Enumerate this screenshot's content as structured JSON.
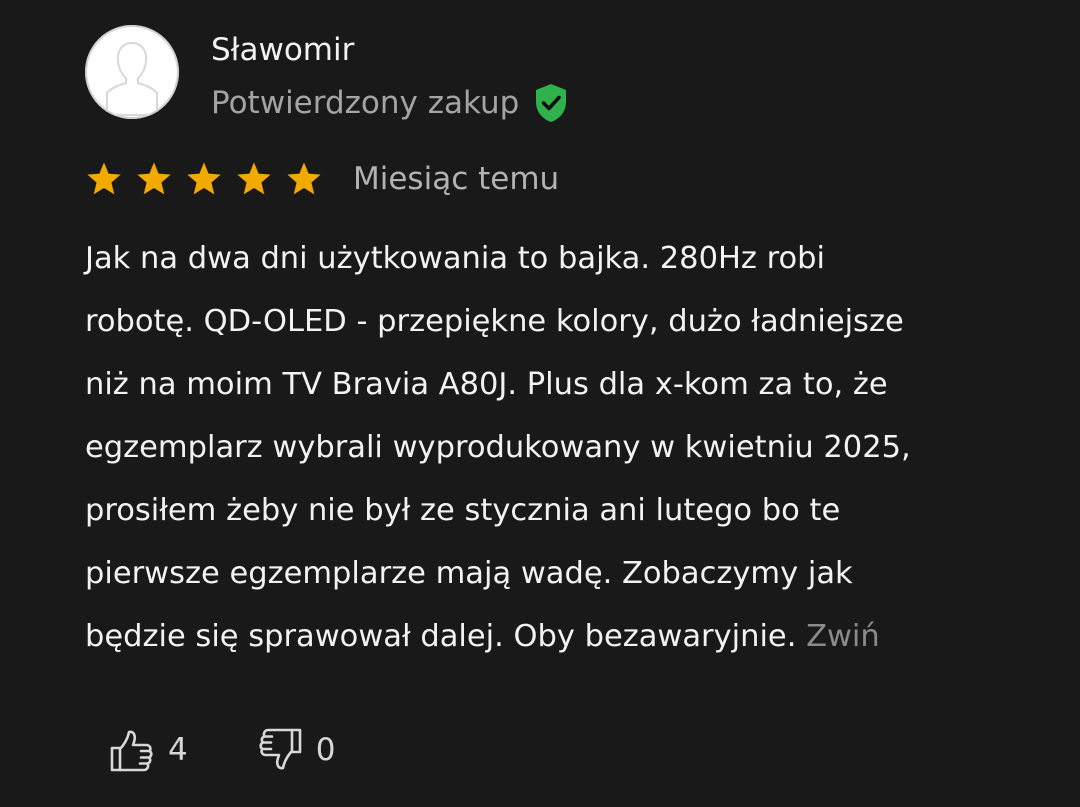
{
  "review": {
    "author": "Sławomir",
    "verified_label": "Potwierdzony zakup",
    "rating": 5,
    "rating_max": 5,
    "date": "Miesiąc temu",
    "body_lines": [
      "Jak na dwa dni użytkowania to bajka. 280Hz robi",
      "robotę. QD-OLED - przepiękne kolory, dużo ładniejsze",
      "niż na moim TV Bravia A80J. Plus dla x-kom za to, że",
      "egzemplarz wybrali wyprodukowany w kwietniu 2025,",
      "prosiłem żeby nie był ze stycznia ani lutego bo te",
      "pierwsze egzemplarze mają wadę. Zobaczymy jak",
      "będzie się sprawował dalej. Oby bezawaryjnie."
    ],
    "collapse_label": "Zwiń",
    "likes": "4",
    "dislikes": "0"
  },
  "icons": {
    "avatar": "user-silhouette-icon",
    "verified": "shield-check-icon",
    "star": "star-icon",
    "like": "thumbs-up-icon",
    "dislike": "thumbs-down-icon"
  },
  "colors": {
    "background": "#19191a",
    "text": "#f2f2f2",
    "muted": "#a4a4a4",
    "star": "#f2a900",
    "verified": "#2fb24c"
  }
}
